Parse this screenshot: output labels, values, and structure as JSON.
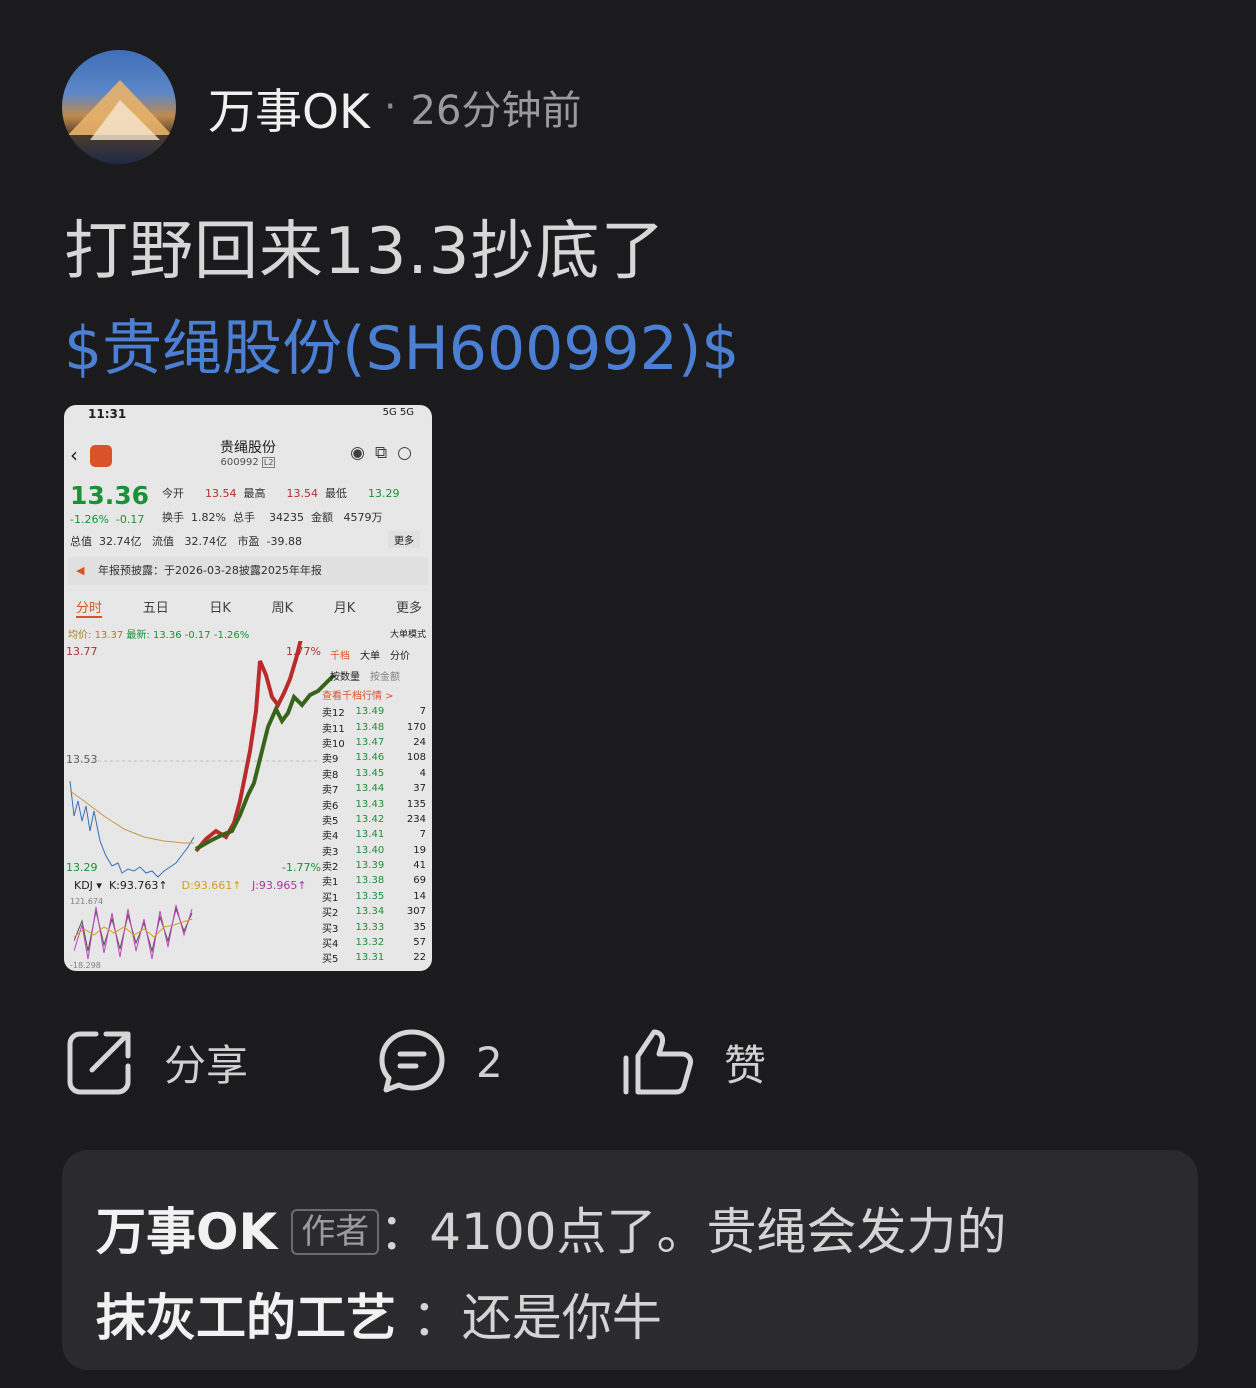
{
  "post": {
    "user_name": "万事OK",
    "separator": "·",
    "time": "26分钟前",
    "text": "打野回来13.3抄底了",
    "stock_link": "$贵绳股份(SH600992)$"
  },
  "screenshot": {
    "status_time": "11:31",
    "status_right": "5G 5G",
    "stock_name": "贵绳股份",
    "stock_code": "600992",
    "code_badge": "L2",
    "price": "13.36",
    "change_pct": "-1.26%",
    "change_abs": "-0.17",
    "row1": {
      "open_label": "今开",
      "open": "13.54",
      "high_label": "最高",
      "high": "13.54",
      "low_label": "最低",
      "low": "13.29"
    },
    "row2": {
      "turnover_label": "换手",
      "turnover": "1.82%",
      "volume_label": "总手",
      "volume": "34235",
      "amount_label": "金额",
      "amount": "4579万"
    },
    "row3": {
      "mcap_label": "总值",
      "mcap": "32.74亿",
      "float_label": "流值",
      "float": "32.74亿",
      "pe_label": "市盈",
      "pe": "-39.88",
      "more": "更多"
    },
    "notice": "年报预披露：于2026-03-28披露2025年年报",
    "tabs": [
      "分时",
      "五日",
      "日K",
      "周K",
      "月K",
      "更多"
    ],
    "avg_line": {
      "avg_label": "均价:",
      "avg": "13.37",
      "latest_label": "最新:",
      "latest": "13.36",
      "chg": "-0.17",
      "pct": "-1.26%"
    },
    "big_order": "大单模式",
    "y_labels": {
      "top": "13.77",
      "mid": "13.53",
      "bottom": "13.29",
      "pct_top": "1.77%",
      "pct_bottom": "-1.77%"
    },
    "orderbook_tabs": [
      "千档",
      "大单",
      "分价"
    ],
    "orderbook_sub": [
      "按数量",
      "按金额"
    ],
    "orderbook_link": "查看千档行情 >",
    "asks": [
      {
        "label": "卖12",
        "price": "13.49",
        "vol": "7"
      },
      {
        "label": "卖11",
        "price": "13.48",
        "vol": "170"
      },
      {
        "label": "卖10",
        "price": "13.47",
        "vol": "24"
      },
      {
        "label": "卖9",
        "price": "13.46",
        "vol": "108"
      },
      {
        "label": "卖8",
        "price": "13.45",
        "vol": "4"
      },
      {
        "label": "卖7",
        "price": "13.44",
        "vol": "37"
      },
      {
        "label": "卖6",
        "price": "13.43",
        "vol": "135"
      },
      {
        "label": "卖5",
        "price": "13.42",
        "vol": "234"
      },
      {
        "label": "卖4",
        "price": "13.41",
        "vol": "7"
      },
      {
        "label": "卖3",
        "price": "13.40",
        "vol": "19"
      },
      {
        "label": "卖2",
        "price": "13.39",
        "vol": "41"
      },
      {
        "label": "卖1",
        "price": "13.38",
        "vol": "69"
      }
    ],
    "bids": [
      {
        "label": "买1",
        "price": "13.35",
        "vol": "14"
      },
      {
        "label": "买2",
        "price": "13.34",
        "vol": "307"
      },
      {
        "label": "买3",
        "price": "13.33",
        "vol": "35"
      },
      {
        "label": "买4",
        "price": "13.32",
        "vol": "57"
      },
      {
        "label": "买5",
        "price": "13.31",
        "vol": "22"
      }
    ],
    "kdj": {
      "name": "KDJ",
      "k": "K:93.763↑",
      "d": "D:93.661↑",
      "j": "J:93.965↑",
      "top": "121.674",
      "bottom": "-18.298"
    }
  },
  "actions": {
    "share_label": "分享",
    "comment_count": "2",
    "like_label": "赞"
  },
  "comments": [
    {
      "name": "万事OK",
      "badge": "作者",
      "text": "：4100点了。贵绳会发力的"
    },
    {
      "name": "抹灰工的工艺",
      "badge": "",
      "text": "：还是你牛"
    }
  ]
}
